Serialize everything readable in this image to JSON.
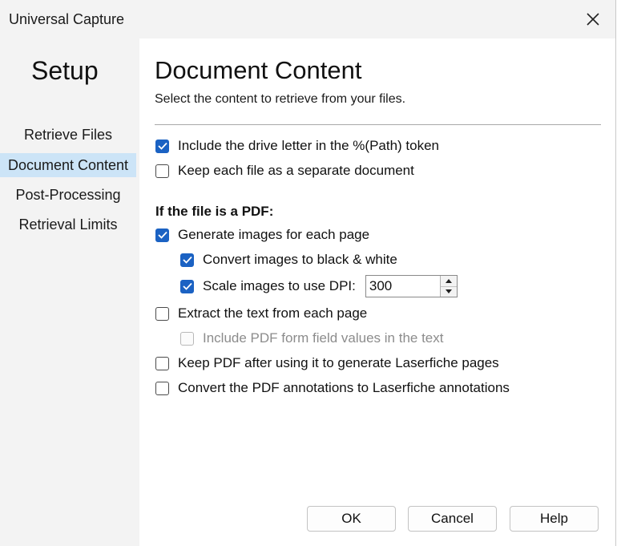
{
  "window": {
    "title": "Universal Capture"
  },
  "sidebar": {
    "title": "Setup",
    "items": [
      {
        "label": "Retrieve Files",
        "active": false
      },
      {
        "label": "Document Content",
        "active": true
      },
      {
        "label": "Post-Processing",
        "active": false
      },
      {
        "label": "Retrieval Limits",
        "active": false
      }
    ]
  },
  "content": {
    "heading": "Document Content",
    "subheading": "Select the content to retrieve from your files.",
    "options": {
      "include_drive_letter": {
        "label": "Include the drive letter in the %(Path) token",
        "checked": true
      },
      "keep_separate": {
        "label": "Keep each file as a separate document",
        "checked": false
      }
    },
    "pdf_section_label": "If the file is a PDF:",
    "pdf_options": {
      "generate_images": {
        "label": "Generate images for each page",
        "checked": true
      },
      "black_white": {
        "label": "Convert images to black & white",
        "checked": true
      },
      "scale_dpi": {
        "label": "Scale images to use DPI:",
        "checked": true,
        "value": "300"
      },
      "extract_text": {
        "label": "Extract the text from each page",
        "checked": false
      },
      "form_fields": {
        "label": "Include PDF form field values in the text",
        "checked": false,
        "disabled": true
      },
      "keep_pdf": {
        "label": "Keep PDF after using it to generate Laserfiche pages",
        "checked": false
      },
      "convert_annotations": {
        "label": "Convert the PDF annotations to Laserfiche annotations",
        "checked": false
      }
    }
  },
  "buttons": {
    "ok": "OK",
    "cancel": "Cancel",
    "help": "Help"
  },
  "icons": {
    "close": "close-icon",
    "check": "checkmark-icon",
    "spin_up": "triangle-up-icon",
    "spin_down": "triangle-down-icon"
  },
  "colors": {
    "accent": "#1b62c3",
    "selection": "#cce4f7"
  }
}
